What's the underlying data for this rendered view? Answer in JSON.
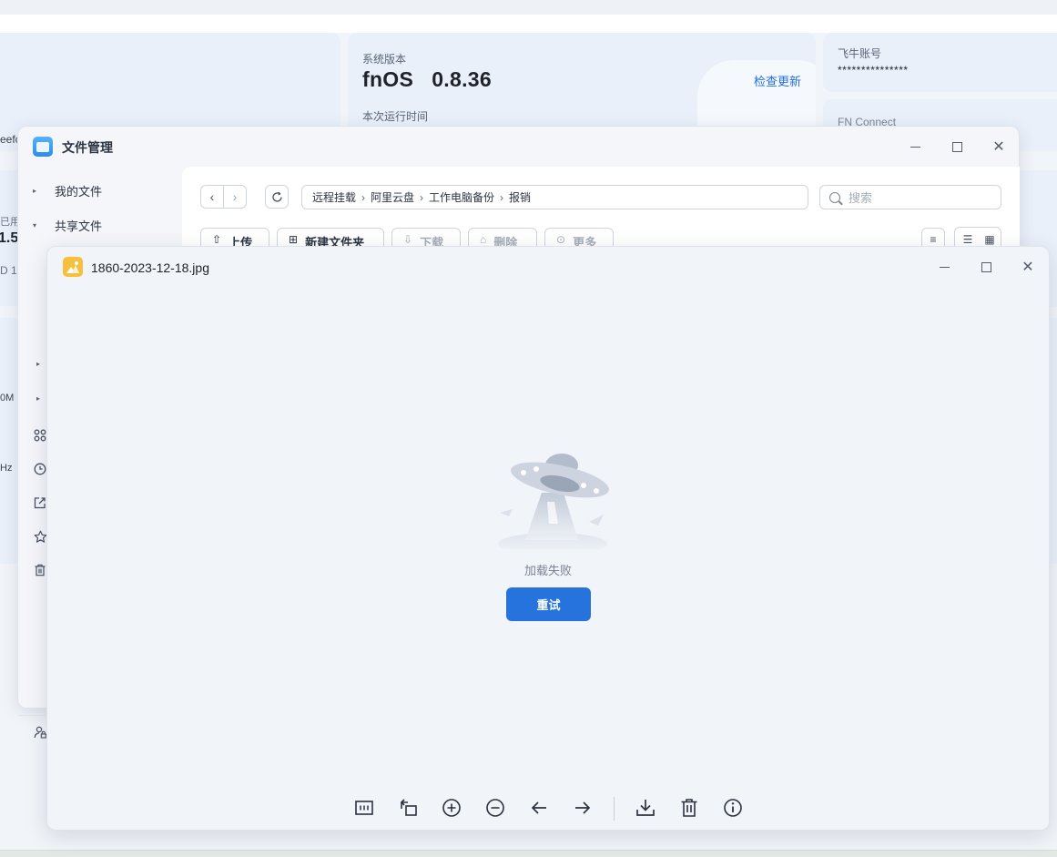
{
  "desktop": {
    "version_label": "系统版本",
    "version_value": "fnOS   0.8.36",
    "check_update": "检查更新",
    "uptime_label": "本次运行时间",
    "account_label": "飞牛账号",
    "account_value": "***************",
    "connect_label": "FN Connect",
    "clip_texts": [
      "eefc",
      "已用",
      "1.5",
      "D 1",
      "0M",
      "Hz"
    ]
  },
  "file_manager": {
    "title": "文件管理",
    "sidebar": {
      "my_files": "我的文件",
      "shared_files": "共享文件"
    },
    "path": [
      "远程挂载",
      "阿里云盘",
      "工作电脑备份",
      "报销"
    ],
    "search_placeholder": "搜索",
    "toolbar": {
      "upload": "上传",
      "new_folder": "新建文件夹",
      "download": "下载",
      "delete": "删除",
      "more": "更多"
    }
  },
  "image_viewer": {
    "filename": "1860-2023-12-18.jpg",
    "load_failed": "加载失败",
    "retry": "重试",
    "tools": [
      "fit-to-window",
      "rotate",
      "zoom-in",
      "zoom-out",
      "previous",
      "next",
      "download",
      "delete",
      "info"
    ]
  },
  "colors": {
    "accent": "#2673dd",
    "link": "#1f6fde",
    "window_bg": "#f1f4f9"
  }
}
